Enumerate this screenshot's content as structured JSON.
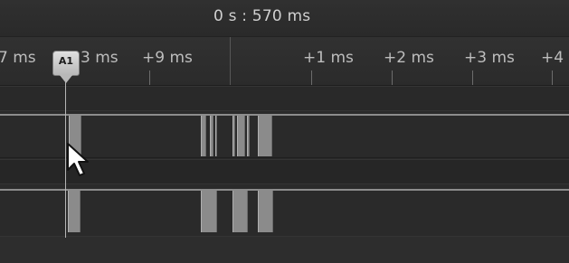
{
  "header": {
    "timebase": "0 s : 570 ms"
  },
  "ruler": {
    "ticks": [
      {
        "label": "7 ms"
      },
      {
        "label": "3 ms"
      },
      {
        "label": "+9 ms"
      },
      {
        "label": "+1 ms"
      },
      {
        "label": "+2 ms"
      },
      {
        "label": "+3 ms"
      },
      {
        "label": "+4"
      }
    ]
  },
  "marker": {
    "label": "A1"
  },
  "channels": {
    "channel_1": {
      "name": ""
    },
    "channel_2": {
      "name": ""
    }
  },
  "icons": {
    "marker": "timing-marker-icon",
    "cursor": "mouse-pointer-icon"
  },
  "colors": {
    "background": "#2a2a2a",
    "signal": "#8b8b8b",
    "text": "#c8c8c8"
  }
}
